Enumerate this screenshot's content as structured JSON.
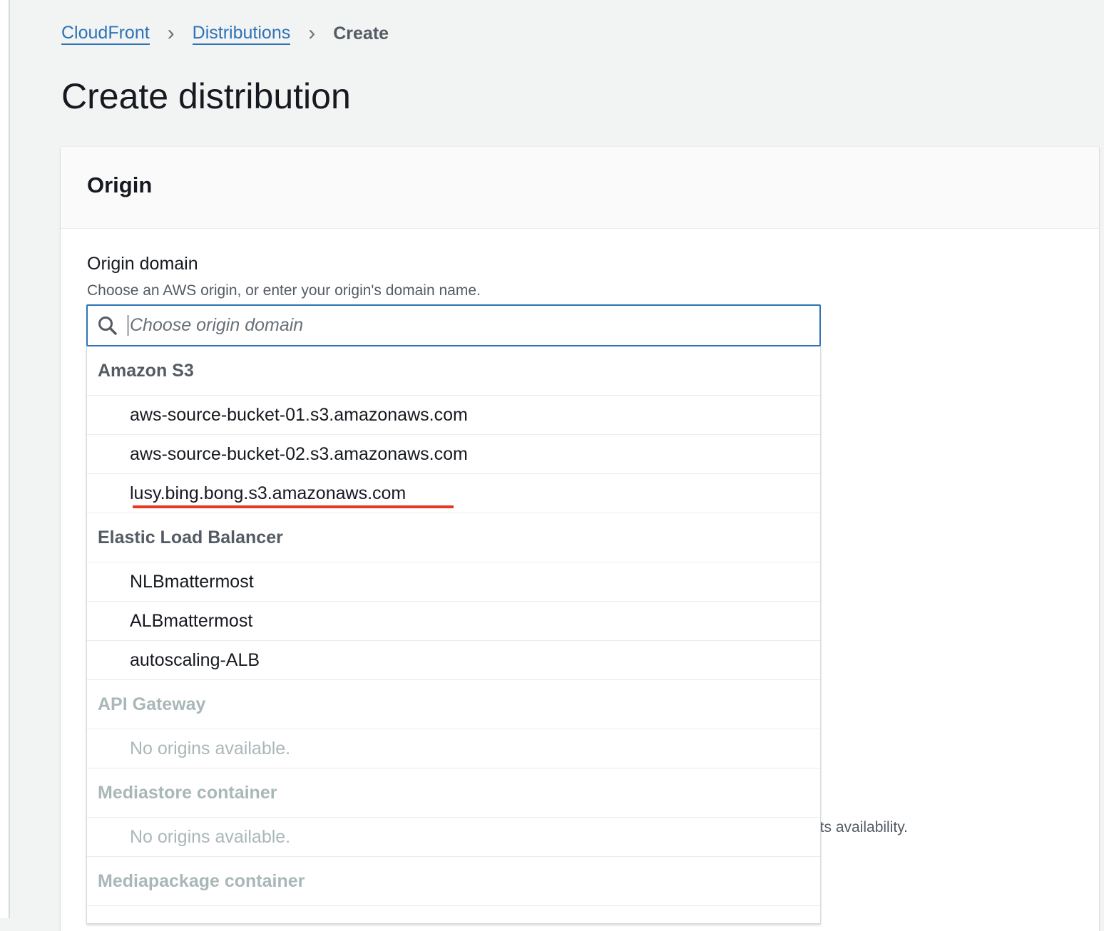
{
  "breadcrumb": {
    "items": [
      "CloudFront",
      "Distributions"
    ],
    "current": "Create"
  },
  "page_title": "Create distribution",
  "section": {
    "title": "Origin"
  },
  "origin_domain": {
    "label": "Origin domain",
    "description": "Choose an AWS origin, or enter your origin's domain name.",
    "placeholder": "Choose origin domain",
    "value": ""
  },
  "obscured_text": "its availability.",
  "dropdown": {
    "groups": [
      {
        "label": "Amazon S3",
        "options": [
          "aws-source-bucket-01.s3.amazonaws.com",
          "aws-source-bucket-02.s3.amazonaws.com",
          "lusy.bing.bong.s3.amazonaws.com"
        ]
      },
      {
        "label": "Elastic Load Balancer",
        "options": [
          "NLBmattermost",
          "ALBmattermost",
          "autoscaling-ALB"
        ]
      },
      {
        "label": "API Gateway",
        "empty": "No origins available."
      },
      {
        "label": "Mediastore container",
        "empty": "No origins available."
      },
      {
        "label": "Mediapackage container"
      }
    ]
  },
  "colors": {
    "link": "#2e73b8",
    "focus": "#2e73b8",
    "annotation": "#e8391f",
    "disabled": "#aab7b8"
  }
}
